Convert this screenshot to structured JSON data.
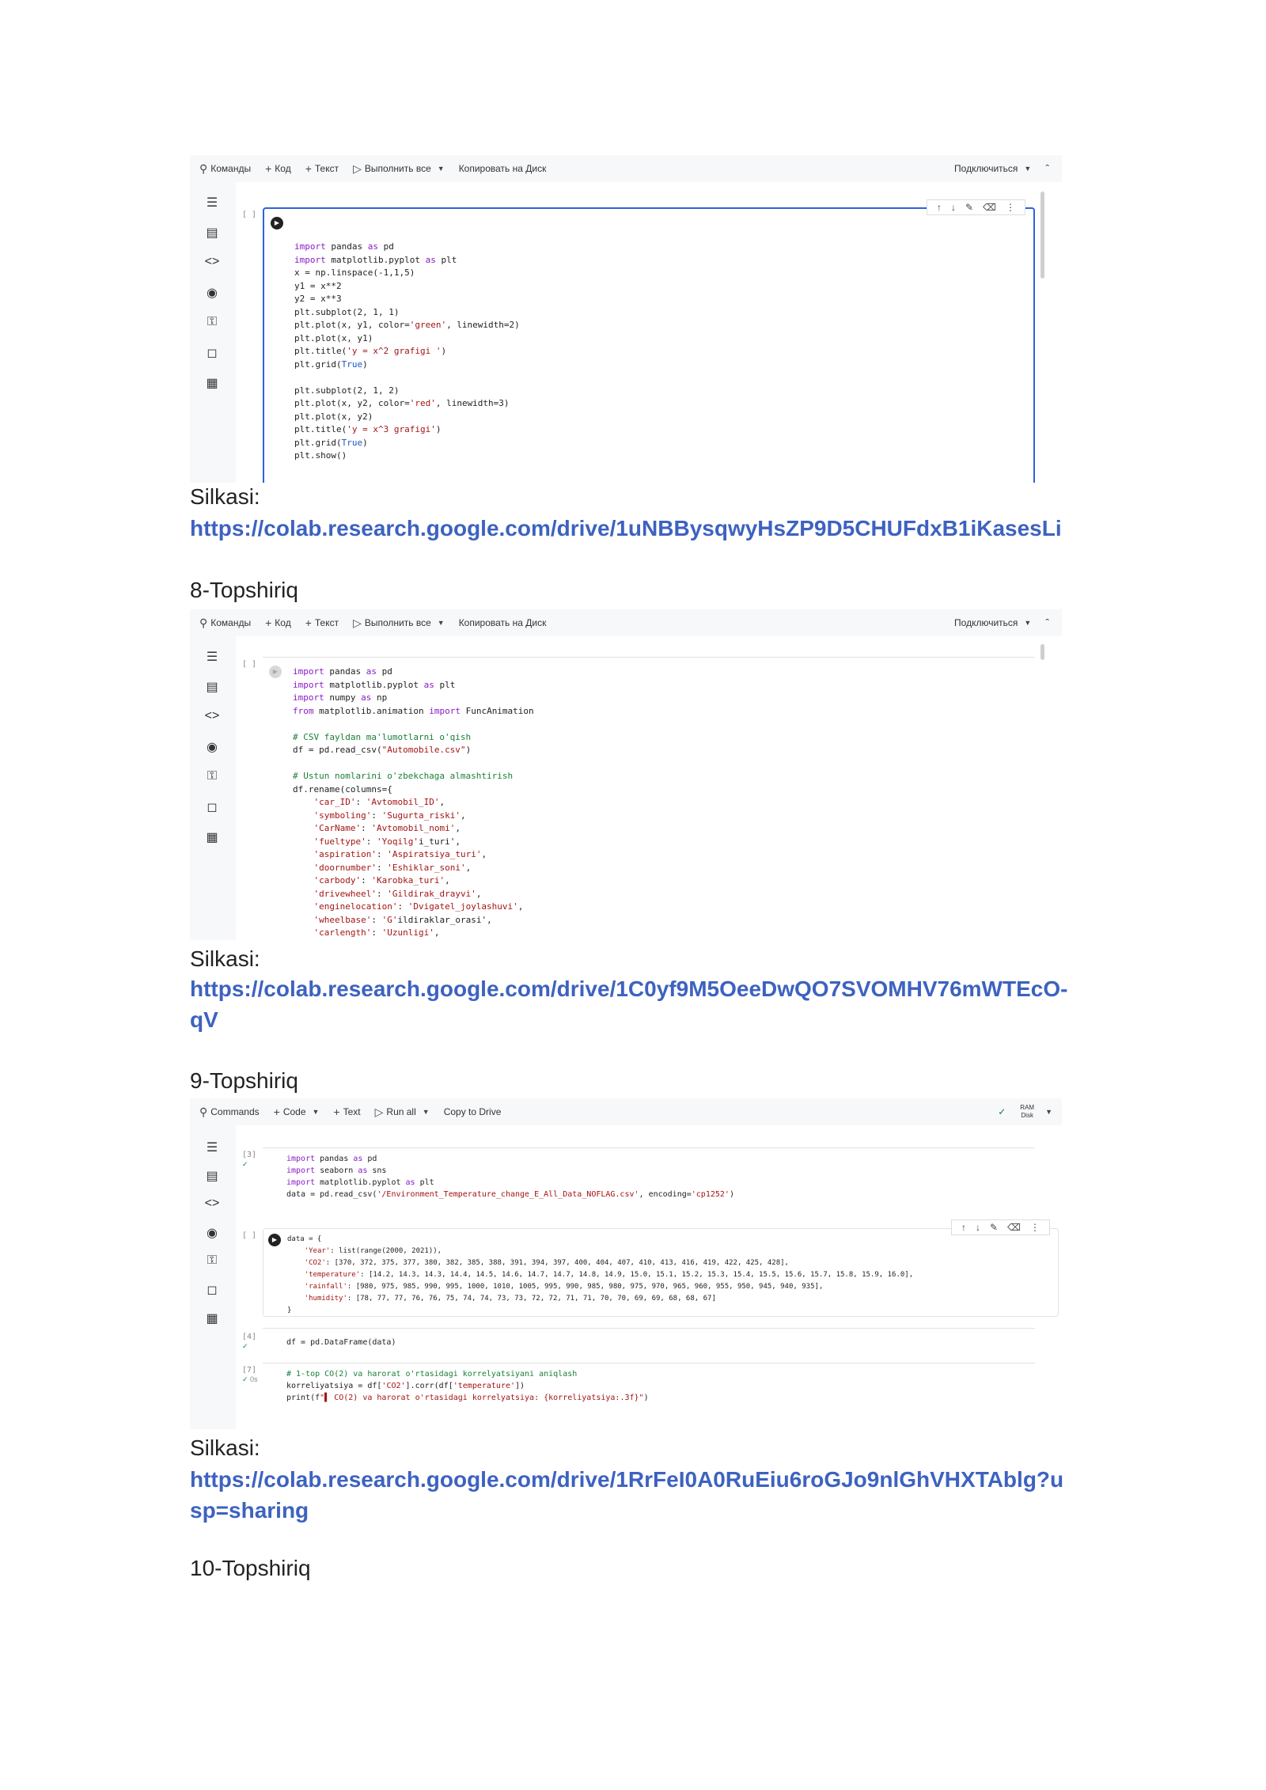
{
  "shot1": {
    "toolbar_ru": [
      "Команды",
      "Код",
      "Текст",
      "Выполнить все",
      "Копировать на Диск"
    ],
    "connect": "Подключиться",
    "bracket": "[ ]",
    "code": [
      "import pandas as pd",
      "import matplotlib.pyplot as plt",
      "x = np.linspace(-1,1,5)",
      "y1 = x**2",
      "y2 = x**3",
      "plt.subplot(2, 1, 1)",
      "plt.plot(x, y1, color='green', linewidth=2)",
      "plt.plot(x, y1)",
      "plt.title('y = x^2 grafigi ')",
      "plt.grid(True)",
      "",
      "plt.subplot(2, 1, 2)",
      "plt.plot(x, y2, color='red', linewidth=3)",
      "plt.plot(x, y2)",
      "plt.title('y = x^3 grafigi')",
      "plt.grid(True)",
      "plt.show()"
    ]
  },
  "silkasi1": "Silkasi:",
  "link1": "https://colab.research.google.com/drive/1uNBBysqwyHsZP9D5CHUFdxB1iKasesLi",
  "heading8": "8-Topshiriq",
  "shot2": {
    "toolbar_ru": [
      "Команды",
      "Код",
      "Текст",
      "Выполнить все",
      "Копировать на Диск"
    ],
    "connect": "Подключиться",
    "bracket": "[ ]",
    "code": [
      "import pandas as pd",
      "import matplotlib.pyplot as plt",
      "import numpy as np",
      "from matplotlib.animation import FuncAnimation",
      "",
      "# CSV fayldan ma'lumotlarni o'qish",
      "df = pd.read_csv(\"Automobile.csv\")",
      "",
      "# Ustun nomlarini o'zbekchaga almashtirish",
      "df.rename(columns={",
      "    'car_ID': 'Avtomobil_ID',",
      "    'symboling': 'Sugurta_riski',",
      "    'CarName': 'Avtomobil_nomi',",
      "    'fueltype': 'Yoqilg'i_turi',",
      "    'aspiration': 'Aspiratsiya_turi',",
      "    'doornumber': 'Eshiklar_soni',",
      "    'carbody': 'Karobka_turi',",
      "    'drivewheel': 'Gildirak_drayvi',",
      "    'enginelocation': 'Dvigatel_joylashuvi',",
      "    'wheelbase': 'G'ildiraklar_orasi',",
      "    'carlength': 'Uzunligi',"
    ]
  },
  "silkasi2": "Silkasi:",
  "link2": "https://colab.research.google.com/drive/1C0yf9M5OeeDwQO7SVOMHV76mWTEcO-qV",
  "heading9": "9-Topshiriq",
  "shot3": {
    "toolbar_en": [
      "Commands",
      "Code",
      "Text",
      "Run all",
      "Copy to Drive"
    ],
    "ram": "RAM",
    "disk": "Disk",
    "cell1_bracket": "[3]",
    "cell1": [
      "import pandas as pd",
      "import seaborn as sns",
      "import matplotlib.pyplot as plt",
      "data = pd.read_csv('/Environment_Temperature_change_E_All_Data_NOFLAG.csv', encoding='cp1252')"
    ],
    "cell2_bracket": "[ ]",
    "cell2": [
      "data = {",
      "    'Year': list(range(2000, 2021)),",
      "    'CO2': [370, 372, 375, 377, 380, 382, 385, 388, 391, 394, 397, 400, 404, 407, 410, 413, 416, 419, 422, 425, 428],",
      "    'temperature': [14.2, 14.3, 14.3, 14.4, 14.5, 14.6, 14.7, 14.7, 14.8, 14.9, 15.0, 15.1, 15.2, 15.3, 15.4, 15.5, 15.6, 15.7, 15.8, 15.9, 16.0],",
      "    'rainfall': [980, 975, 985, 990, 995, 1000, 1010, 1005, 995, 990, 985, 980, 975, 970, 965, 960, 955, 950, 945, 940, 935],",
      "    'humidity': [78, 77, 77, 76, 76, 75, 74, 74, 73, 73, 72, 72, 71, 71, 70, 70, 69, 69, 68, 68, 67]",
      "}"
    ],
    "cell3_bracket": "[4]",
    "cell3": [
      "df = pd.DataFrame(data)"
    ],
    "cell4_bracket": "[7]",
    "cell4_time": "0s",
    "cell4": [
      "# 1-top CO(2) va harorat o'rtasidagi korrelyatsiyani aniqlash",
      "korreliyatsiya = df['CO2'].corr(df['temperature'])",
      "print(f\"▌ CO(2) va harorat o'rtasidagi korrelyatsiya: {korreliyatsiya:.3f}\")"
    ]
  },
  "silkasi3": "Silkasi:",
  "link3": "https://colab.research.google.com/drive/1RrFeI0A0RuEiu6roGJo9nlGhVHXTAblg?usp=sharing",
  "heading10": "10-Topshiriq",
  "icons": {
    "sidebar": [
      "toc-icon",
      "find-icon",
      "code-snippets-icon",
      "variables-icon",
      "secrets-icon",
      "folder-icon",
      "terminal-table-icon"
    ]
  }
}
